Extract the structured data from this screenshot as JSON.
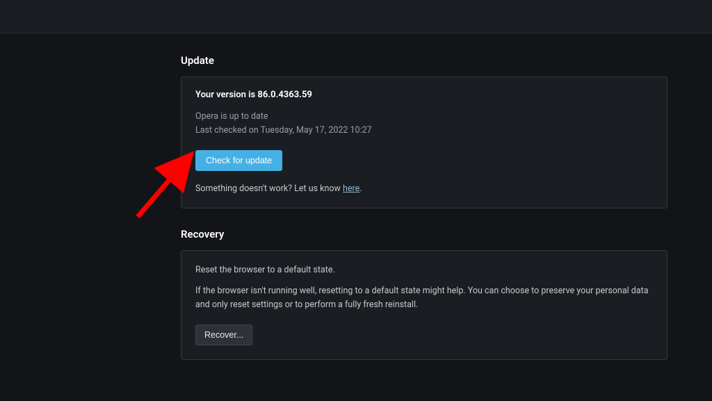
{
  "update": {
    "heading": "Update",
    "version_label": "Your version is ",
    "version_number": "86.0.4363.59",
    "status_line": "Opera is up to date",
    "last_checked": "Last checked on Tuesday, May 17, 2022 10:27",
    "check_button": "Check for update",
    "feedback_prefix": "Something doesn't work? Let us know ",
    "feedback_link": "here",
    "feedback_suffix": "."
  },
  "recovery": {
    "heading": "Recovery",
    "reset_title": "Reset the browser to a default state.",
    "reset_desc": "If the browser isn't running well, resetting to a default state might help. You can choose to preserve your personal data and only reset settings or to perform a fully fresh reinstall.",
    "recover_button": "Recover..."
  }
}
